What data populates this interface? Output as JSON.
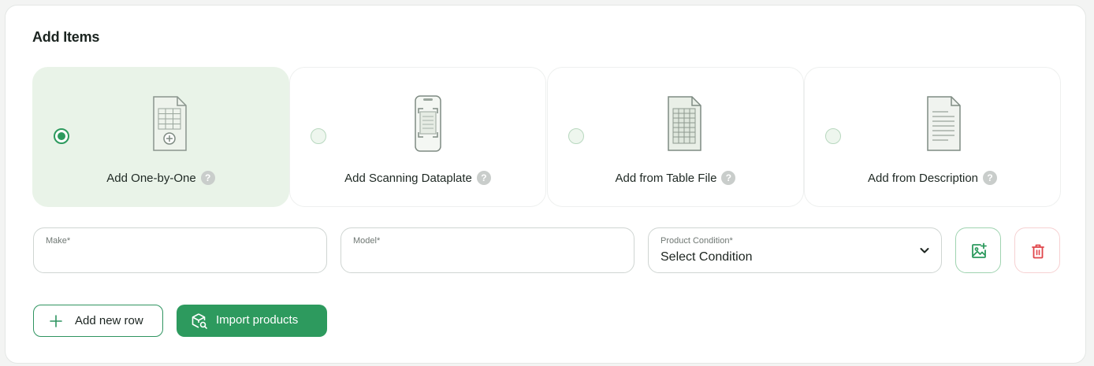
{
  "section": {
    "title": "Add Items"
  },
  "options": [
    {
      "label": "Add One-by-One",
      "selected": true,
      "icon": "add-document-icon"
    },
    {
      "label": "Add Scanning Dataplate",
      "selected": false,
      "icon": "phone-scan-icon"
    },
    {
      "label": "Add from Table File",
      "selected": false,
      "icon": "table-file-icon"
    },
    {
      "label": "Add from Description",
      "selected": false,
      "icon": "text-document-icon"
    }
  ],
  "help_glyph": "?",
  "form": {
    "make": {
      "label": "Make*",
      "value": ""
    },
    "model": {
      "label": "Model*",
      "value": ""
    },
    "condition": {
      "label": "Product Condition*",
      "value": "Select Condition"
    }
  },
  "buttons": {
    "add_row": "Add new row",
    "import": "Import products",
    "add_image_icon": "add-image-icon",
    "delete_icon": "trash-icon"
  },
  "colors": {
    "accent": "#2d9a5e",
    "selected_bg": "#e9f3e8",
    "danger": "#e0454a"
  }
}
